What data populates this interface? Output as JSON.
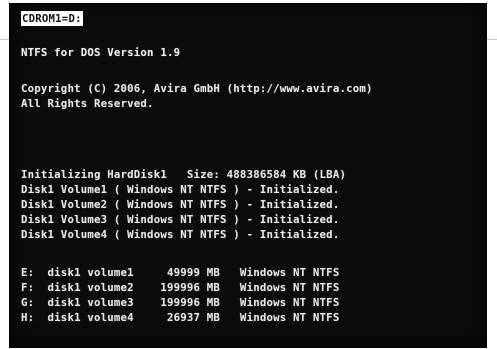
{
  "console": {
    "prompt": "CDROM1=D:",
    "version": "NTFS for DOS Version 1.9",
    "copyright": "Copyright (C) 2006, Avira GmbH (http://www.avira.com)",
    "rights": "All Rights Reserved.",
    "init_line": "Initializing HardDisk1   Size: 488386584 KB (LBA)",
    "volumes_initialized": [
      "Disk1 Volume1 ( Windows NT NTFS ) - Initialized.",
      "Disk1 Volume2 ( Windows NT NTFS ) - Initialized.",
      "Disk1 Volume3 ( Windows NT NTFS ) - Initialized.",
      "Disk1 Volume4 ( Windows NT NTFS ) - Initialized."
    ],
    "drive_map": [
      "E:  disk1 volume1     49999 MB   Windows NT NTFS",
      "F:  disk1 volume2    199996 MB   Windows NT NTFS",
      "G:  disk1 volume3    199996 MB   Windows NT NTFS",
      "H:  disk1 volume4     26937 MB   Windows NT NTFS"
    ]
  },
  "colors": {
    "screen_background": "#0b0b0b",
    "text": "#e6e6e6",
    "prompt_highlight": "#ffffff"
  }
}
